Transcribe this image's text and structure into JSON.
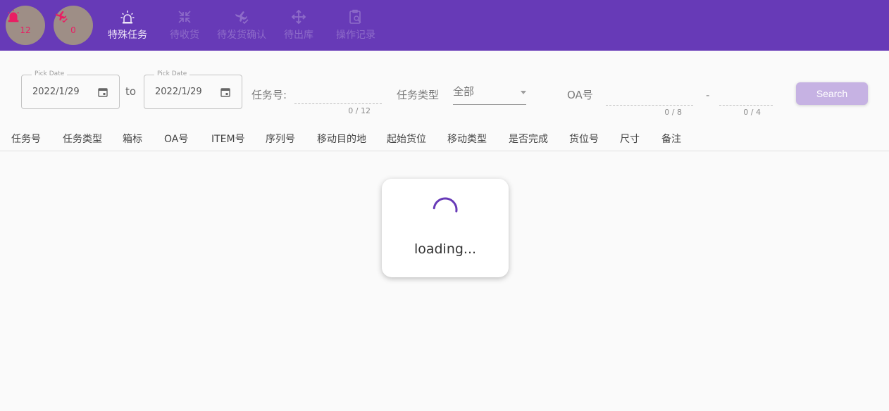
{
  "header": {
    "badges": [
      {
        "icon": "alarm-siren-icon",
        "count": "12"
      },
      {
        "icon": "flight-check-icon",
        "count": "0"
      }
    ],
    "nav": [
      {
        "icon": "alert-light-icon",
        "label": "特殊任务",
        "active": true
      },
      {
        "icon": "compress-arrows-icon",
        "label": "待收货"
      },
      {
        "icon": "airplane-check-icon",
        "label": "待发货确认"
      },
      {
        "icon": "move-arrows-icon",
        "label": "待出库"
      },
      {
        "icon": "clipboard-search-icon",
        "label": "操作记录"
      }
    ]
  },
  "filters": {
    "date_from": {
      "legend": "Pick Date",
      "value": "2022/1/29"
    },
    "to_label": "to",
    "date_to": {
      "legend": "Pick Date",
      "value": "2022/1/29"
    },
    "task_no": {
      "label": "任务号:",
      "value": "",
      "counter": "0 / 12"
    },
    "task_type": {
      "label": "任务类型",
      "selected": "全部"
    },
    "oa_no": {
      "label": "OA号",
      "value": "",
      "counter": "0 / 8"
    },
    "separator": "-",
    "oa_suffix": {
      "value": "",
      "counter": "0 / 4"
    },
    "search_label": "Search"
  },
  "table": {
    "columns": [
      "任务号",
      "任务类型",
      "箱标",
      "OA号",
      "ITEM号",
      "序列号",
      "移动目的地",
      "起始货位",
      "移动类型",
      "是否完成",
      "货位号",
      "尺寸",
      "备注"
    ]
  },
  "loading": {
    "text": "loading..."
  },
  "colors": {
    "primary": "#673ab7",
    "badge_count": "#e91e63",
    "button": "#c6b2e3"
  }
}
